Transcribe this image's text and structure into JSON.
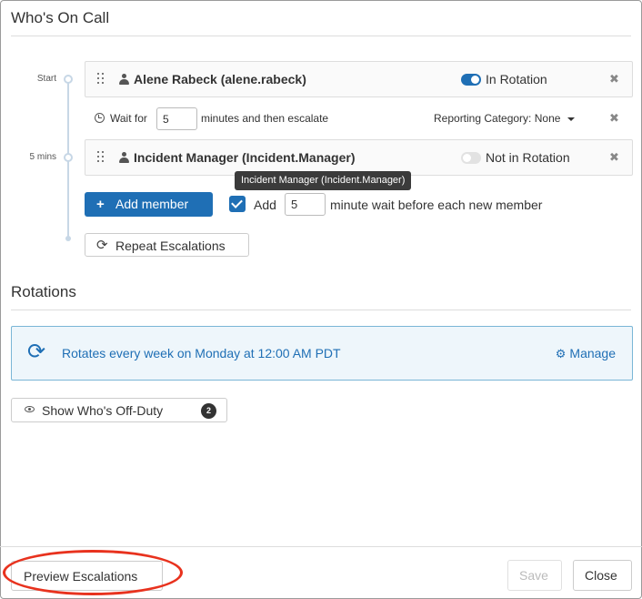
{
  "whos_on_call": {
    "title": "Who's On Call",
    "timeline": {
      "start_label": "Start",
      "step_label": "5 mins"
    },
    "members": [
      {
        "name": "Alene Rabeck (alene.rabeck)",
        "rotation_status": "In Rotation",
        "in_rotation": true
      },
      {
        "name": "Incident Manager (Incident.Manager)",
        "rotation_status": "Not in Rotation",
        "in_rotation": false
      }
    ],
    "wait": {
      "prefix": "Wait for",
      "value": "5",
      "suffix": "minutes and then escalate",
      "reporting_category": "Reporting Category: None"
    },
    "tooltip": "Incident Manager (Incident.Manager)",
    "add_member_label": "Add member",
    "add_wait": {
      "checked": true,
      "prefix": "Add",
      "value": "5",
      "suffix": "minute wait before each new member"
    },
    "repeat_escalations_label": "Repeat Escalations"
  },
  "rotations": {
    "title": "Rotations",
    "schedule_text": "Rotates every week on Monday at 12:00 AM PDT",
    "manage_label": "Manage"
  },
  "off_duty": {
    "label": "Show Who's Off-Duty",
    "count": "2"
  },
  "footer": {
    "preview_label": "Preview Escalations",
    "save_label": "Save",
    "close_label": "Close"
  },
  "colors": {
    "primary": "#1f6fb5",
    "rotation_bg": "#eef6fb",
    "rotation_border": "#7ab6d6",
    "annotation": "#e8321e"
  }
}
